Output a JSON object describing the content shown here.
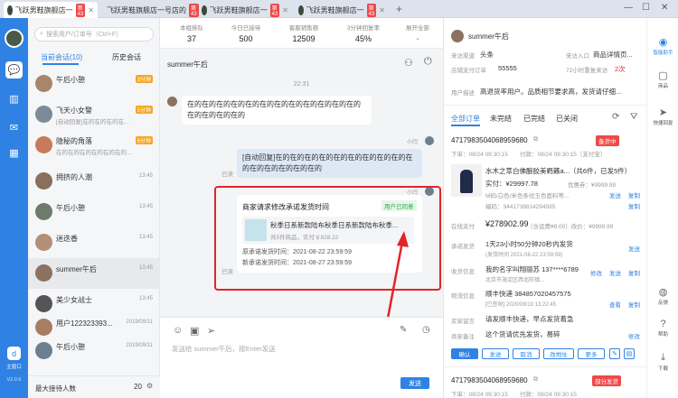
{
  "tabs": [
    {
      "name": "飞跃男鞋旗舰店一",
      "badge": "第43"
    },
    {
      "name": "飞跃男鞋旗舰店一号店的",
      "badge": "第43"
    },
    {
      "name": "飞跃男鞋旗舰店一",
      "badge": "第43"
    },
    {
      "name": "飞跃男鞋旗舰店一",
      "badge": "第43"
    }
  ],
  "sidebar": {
    "bottom_label": "主窗口",
    "version": "V2.0.6"
  },
  "conversations": {
    "search_placeholder": "搜索用户/订单号（Ctrl+F）",
    "tab_current": "当前会话(10)",
    "tab_history": "历史会话",
    "items": [
      {
        "name": "午后小憩",
        "preview": "",
        "time": "",
        "badge": "3分钟"
      },
      {
        "name": "飞天小女警",
        "preview": "[自动回复]在的在的在的在...",
        "time": "",
        "badge": "5分钟"
      },
      {
        "name": "隐秘的角落",
        "preview": "在的在的在的在的在的在的...",
        "time": "",
        "badge": "6分钟"
      },
      {
        "name": "拥挤的人潮",
        "preview": "",
        "time": "13:45",
        "badge": ""
      },
      {
        "name": "午后小憩",
        "preview": "",
        "time": "13:45",
        "badge": ""
      },
      {
        "name": "迷迭香",
        "preview": "",
        "time": "13:45",
        "badge": ""
      },
      {
        "name": "summer午后",
        "preview": "",
        "time": "13:45",
        "badge": ""
      },
      {
        "name": "美少女战士",
        "preview": "",
        "time": "13:45",
        "badge": ""
      },
      {
        "name": "用户122323393...",
        "preview": "",
        "time": "2019/09/11",
        "badge": ""
      },
      {
        "name": "午后小憩",
        "preview": "",
        "time": "2019/09/11",
        "badge": ""
      }
    ],
    "footer_label": "最大接待人数",
    "footer_value": "20"
  },
  "stats": [
    {
      "label": "本组排队",
      "value": "37"
    },
    {
      "label": "今日已接待",
      "value": "500"
    },
    {
      "label": "客服销售额",
      "value": "12509"
    },
    {
      "label": "3分钟回复率",
      "value": "45%"
    },
    {
      "label": "展开全部",
      "value": ""
    }
  ],
  "chat": {
    "title": "summer午后",
    "time": "22:31",
    "msg1": "在的在的在的在的在的在的在的在的在的在的在的在的在的在的在的在的",
    "sender_me": "小闫",
    "msg2": "[自动回复]在的在的在的在的在的在的在的在的在的在的在的在的在的在的在的",
    "read1": "已读",
    "card_title": "商家请求修改承诺发货时间",
    "card_tag": "用户已同意",
    "card_product": "秋季日系新款陆布秋季日系新款陆布秋季...",
    "card_sub": "共5件商品，实付￥828.22",
    "card_orig": "原承诺发货时间：2021-08-22 23:59:59",
    "card_new": "新承诺发货时间：2021-08-27 23:59:59",
    "read2": "已读",
    "input_placeholder": "发送给 summer午后，按Enter发送",
    "send_label": "发送"
  },
  "customer": {
    "name": "summer午后",
    "channel_label": "来访渠道",
    "channel": "头条",
    "entry_label": "来访入口",
    "entry": "商品详情页...",
    "visits_label": "店铺支付订单",
    "visits": "55555",
    "recent_label": "72小时重复来访",
    "recent": "2次",
    "desc_label": "用户描述",
    "desc": "高退货率用户。品质相节要求高，发货请仔细..."
  },
  "order_tabs": [
    "全部订单",
    "未完结",
    "已完结",
    "已关闭"
  ],
  "order": {
    "id": "4717983504068959680",
    "placed": "下单：08/24 09:30:15",
    "paid": "付款：08/24 09:30:15（支付宝）",
    "status": "备货中",
    "product": "水木之萃白佛酿胶美羁籁a...（共6件，已发5件）",
    "price": "实付：¥29997.78",
    "unit": "优惠券：¥9999.99",
    "spec": "M码/白色/米色条纹玉色面料等...",
    "sku": "编码：3441738814294585",
    "send": "发送",
    "copy": "复制",
    "total_label": "在线支付",
    "total": "¥278902.99",
    "total_note": "（含运费¥8.00）改价：¥9999.99",
    "promise_label": "承诺发货",
    "promise": "1天23小时50分钟20秒内发货",
    "promise_sub": "(发货时间 2021-08-22 23:59:59)",
    "addr_label": "收货信息",
    "addr": "我的名字叫翔丽苏 137****6789",
    "addr_sub": "北京市海淀区西北旺镇...",
    "edit": "修改",
    "ship_label": "物流信息",
    "ship": "顺丰快递 384857020457575",
    "ship_sub": "[已签收] 2020/08/10 13:22:45",
    "view": "查看",
    "note_label": "买家留言",
    "note": "请发顺丰快递，早点发货着急",
    "memo_label": "商家备注",
    "memo": "这个货请优先发货，易碎",
    "btn_confirm": "确认",
    "btn_cancel": "取消",
    "btn_addr": "改地址",
    "btn_more": "更多",
    "id2": "4717983504068959680",
    "placed2": "下单：08/24 09:30:15",
    "paid2": "付款：08/24 09:30:15",
    "status2": "部分发货"
  },
  "rightbar": [
    {
      "label": "智能助手",
      "icon": "robot-icon"
    },
    {
      "label": "商品",
      "icon": "box-icon"
    },
    {
      "label": "快捷回复",
      "icon": "send-icon"
    },
    {
      "label": "反馈",
      "icon": "feedback-icon"
    },
    {
      "label": "帮助",
      "icon": "help-icon"
    },
    {
      "label": "下载",
      "icon": "download-icon"
    }
  ],
  "colors": {
    "accent": "#2f82e4",
    "highlight": "#e0252b",
    "badge": "#f5a623"
  }
}
